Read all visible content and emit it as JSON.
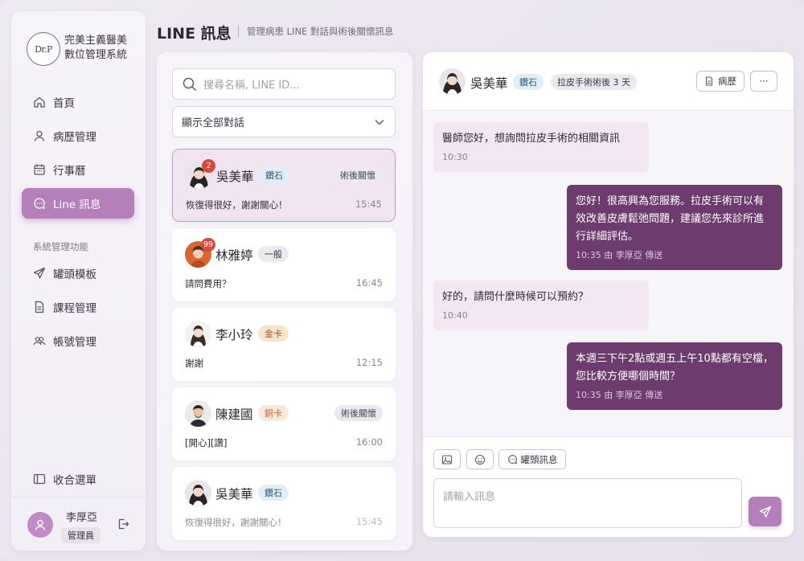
{
  "brand": {
    "logo_text": "Dr.P",
    "line1": "完美主義醫美",
    "line2": "數位管理系統"
  },
  "nav": {
    "items": [
      {
        "label": "首頁",
        "icon": "home-icon"
      },
      {
        "label": "病歷管理",
        "icon": "user-icon"
      },
      {
        "label": "行事曆",
        "icon": "calendar-icon"
      },
      {
        "label": "Line 訊息",
        "icon": "chat-icon",
        "active": true
      }
    ],
    "group_label": "系統管理功能",
    "admin_items": [
      {
        "label": "罐頭模板",
        "icon": "send-icon"
      },
      {
        "label": "課程管理",
        "icon": "document-icon"
      },
      {
        "label": "帳號管理",
        "icon": "users-icon"
      }
    ],
    "collapse_label": "收合選單"
  },
  "user": {
    "name": "李厚亞",
    "role": "管理員"
  },
  "header": {
    "title": "LINE 訊息",
    "subtitle": "管理病患 LINE 對話與術後關懷訊息"
  },
  "list": {
    "search_placeholder": "搜尋名稱, LINE ID...",
    "filter_value": "顯示全部對話",
    "conversations": [
      {
        "name": "吳美華",
        "tier": "鑽石",
        "tag": "術後關懷",
        "message": "恢復得很好，謝謝關心！",
        "time": "15:45",
        "unread": "2"
      },
      {
        "name": "林雅婷",
        "tier": "一般",
        "tag": "",
        "message": "請問費用？",
        "time": "16:45",
        "unread": "99"
      },
      {
        "name": "李小玲",
        "tier": "金卡",
        "tag": "",
        "message": "謝謝",
        "time": "12:15",
        "unread": ""
      },
      {
        "name": "陳建國",
        "tier": "銅卡",
        "tag": "術後關懷",
        "message": "[開心][讚]",
        "time": "16:00",
        "unread": ""
      },
      {
        "name": "吳美華",
        "tier": "鑽石",
        "tag": "",
        "message": "恢復得很好，謝謝關心！",
        "time": "15:45",
        "unread": ""
      }
    ]
  },
  "chat": {
    "name": "吳美華",
    "tier": "鑽石",
    "status": "拉皮手術術後 3 天",
    "record_button": "病歷",
    "more_button": "···",
    "messages": [
      {
        "dir": "in",
        "text": "醫師您好，想詢問拉皮手術的相關資訊",
        "meta": "10:30"
      },
      {
        "dir": "out",
        "text": "您好！很高興為您服務。拉皮手術可以有效改善皮膚鬆弛問題，建議您先來診所進行詳細評估。",
        "meta": "10:35 由 李厚亞 傳送"
      },
      {
        "dir": "in",
        "text": "好的，請問什麼時候可以預約？",
        "meta": "10:40"
      },
      {
        "dir": "out",
        "text": "本週三下午2點或週五上午10點都有空檔，您比較方便哪個時間？",
        "meta": "10:35 由 李厚亞 傳送"
      }
    ],
    "template_button": "罐頭訊息",
    "input_placeholder": "請輸入訊息"
  },
  "colors": {
    "accent": "#b57fb9",
    "outgoing_bubble": "#6e3b6e",
    "incoming_bubble": "#f1e6f1"
  }
}
